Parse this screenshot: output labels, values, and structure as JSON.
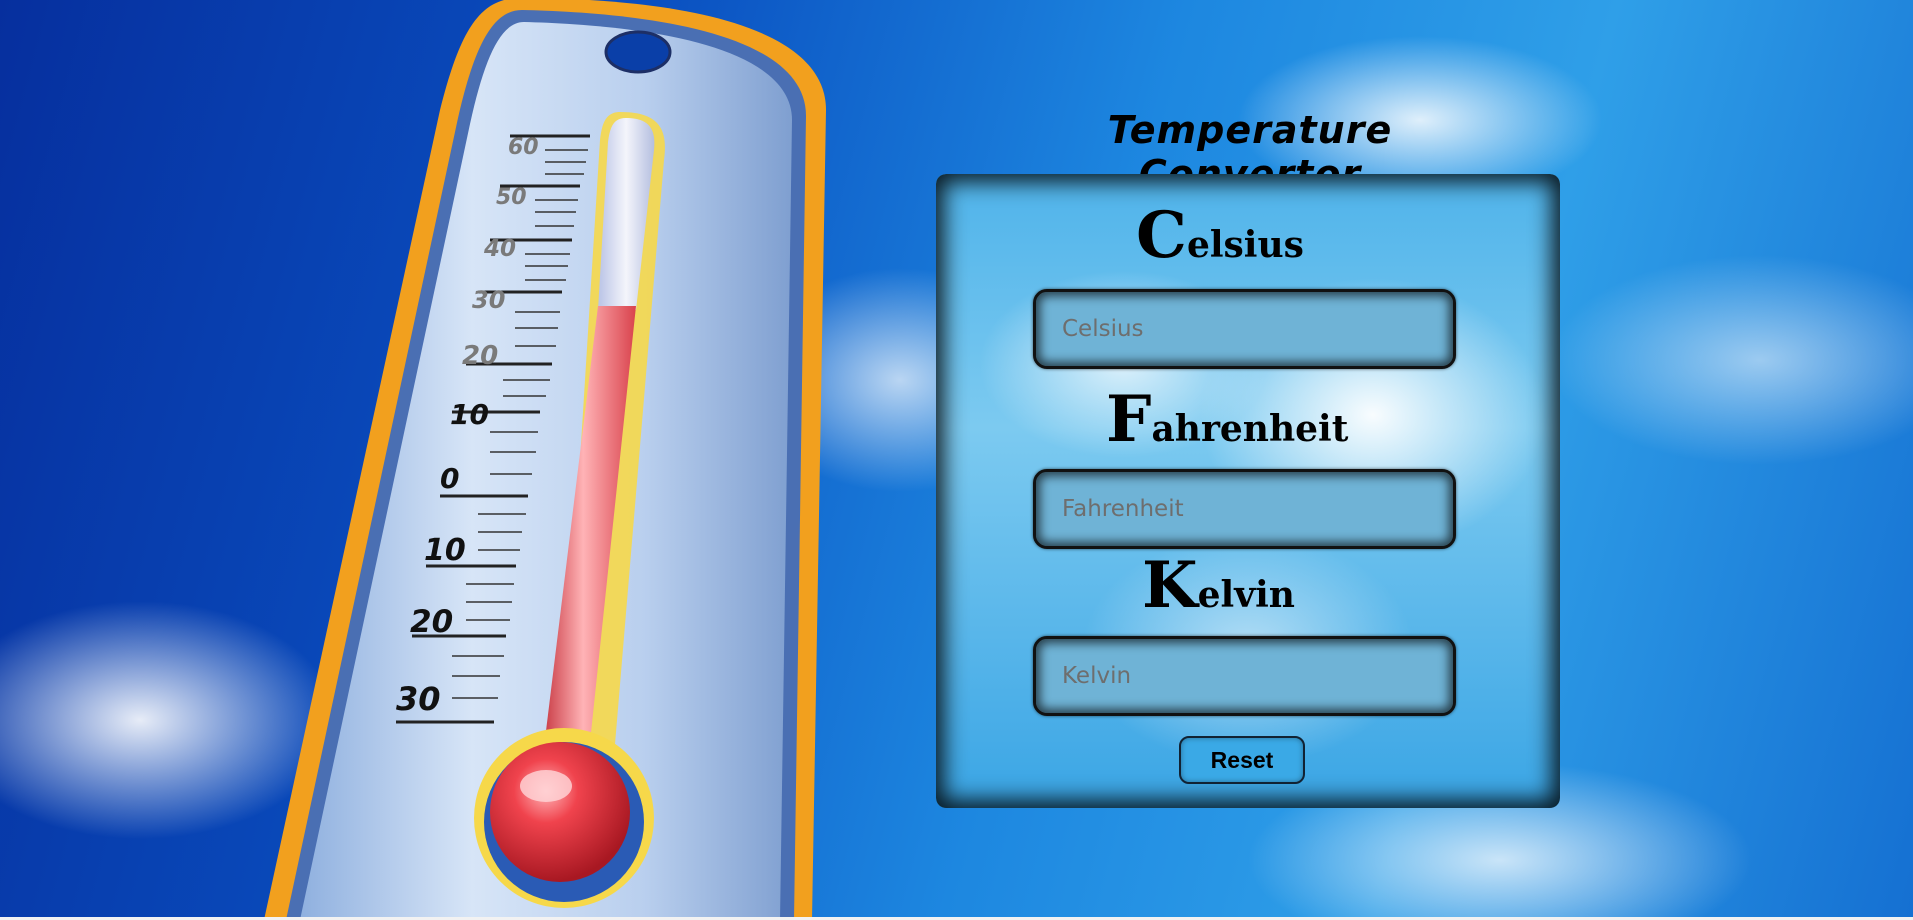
{
  "page": {
    "title": "Temperature Convertor"
  },
  "converter": {
    "celsius": {
      "heading_cap": "C",
      "heading_rest": "elsius",
      "placeholder": "Celsius",
      "value": ""
    },
    "fahrenheit": {
      "heading_cap": "F",
      "heading_rest": "ahrenheit",
      "placeholder": "Fahrenheit",
      "value": ""
    },
    "kelvin": {
      "heading_cap": "K",
      "heading_rest": "elvin",
      "placeholder": "Kelvin",
      "value": ""
    },
    "reset_label": "Reset"
  },
  "thermometer": {
    "scale_labels": [
      "60",
      "50",
      "40",
      "30",
      "20",
      "10",
      "0",
      "10",
      "20",
      "30"
    ],
    "icon": "thermometer-illustration"
  },
  "colors": {
    "sky_dark": "#062f9e",
    "sky_light": "#2f9fe8",
    "thermo_frame": "#f2a01e",
    "thermo_body": "#bcd2ee",
    "mercury": "#e8404a",
    "field_fill": "#6fb3d6"
  }
}
